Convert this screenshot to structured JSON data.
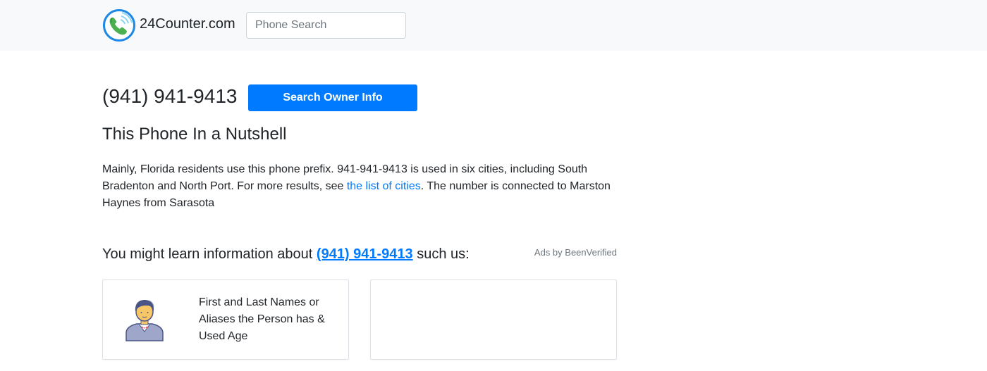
{
  "header": {
    "brand": "24Counter.com",
    "search_placeholder": "Phone Search"
  },
  "main": {
    "phone_number": "(941) 941-9413",
    "search_button_label": "Search Owner Info",
    "nutshell_heading": "This Phone In a Nutshell",
    "summary": {
      "text_before_link": "Mainly, Florida residents use this phone prefix. 941-941-9413 is used in six cities, including South Bradenton and North Port. For more results, see ",
      "link_text": "the list of cities",
      "text_after_link": ". The number is connected to Marston Haynes from Sarasota"
    },
    "learn_section": {
      "prefix": "You might learn information about ",
      "phone_link": "(941) 941-9413",
      "suffix": " such us:",
      "ads_label": "Ads by BeenVerified"
    },
    "cards": [
      {
        "text": "First and Last Names or Aliases the Person has & Used Age",
        "icon": "person-icon"
      },
      {
        "text": ""
      }
    ]
  },
  "colors": {
    "accent": "#007bff",
    "topbar_bg": "#f8f9fa",
    "text": "#212529"
  }
}
